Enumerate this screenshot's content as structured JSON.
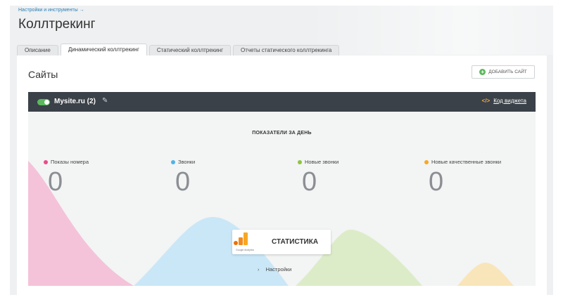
{
  "breadcrumb": "Настройки и инструменты →",
  "page_title": "Коллтрекинг",
  "tabs": [
    {
      "label": "Описание",
      "active": false
    },
    {
      "label": "Динамический коллтрекинг",
      "active": true
    },
    {
      "label": "Статический коллтрекинг",
      "active": false
    },
    {
      "label": "Отчеты статического коллтрекинга",
      "active": false
    }
  ],
  "section": {
    "title": "Сайты",
    "add_button": "ДОБАВИТЬ САЙТ"
  },
  "site": {
    "name": "Mysite.ru (2)",
    "toggle_on": true,
    "widget_link": "Код виджета"
  },
  "stats": {
    "heading": "ПОКАЗАТЕЛИ ЗА ДЕНЬ",
    "metrics": [
      {
        "label": "Показы номера",
        "value": "0",
        "color": "#ea4c89"
      },
      {
        "label": "Звонки",
        "value": "0",
        "color": "#4fb3e8"
      },
      {
        "label": "Новые звонки",
        "value": "0",
        "color": "#8cc63f"
      },
      {
        "label": "Новые качественные звонки",
        "value": "0",
        "color": "#f7a823"
      }
    ],
    "card_title": "СТАТИСТИКА",
    "ga_label": "Google Analytics",
    "settings_link": "Настройки"
  },
  "icons": {
    "add": "plus-circle-icon",
    "edit": "pencil-icon",
    "widget": "code-icon",
    "settings": "chevron-right-icon",
    "analytics": "google-analytics-icon"
  }
}
